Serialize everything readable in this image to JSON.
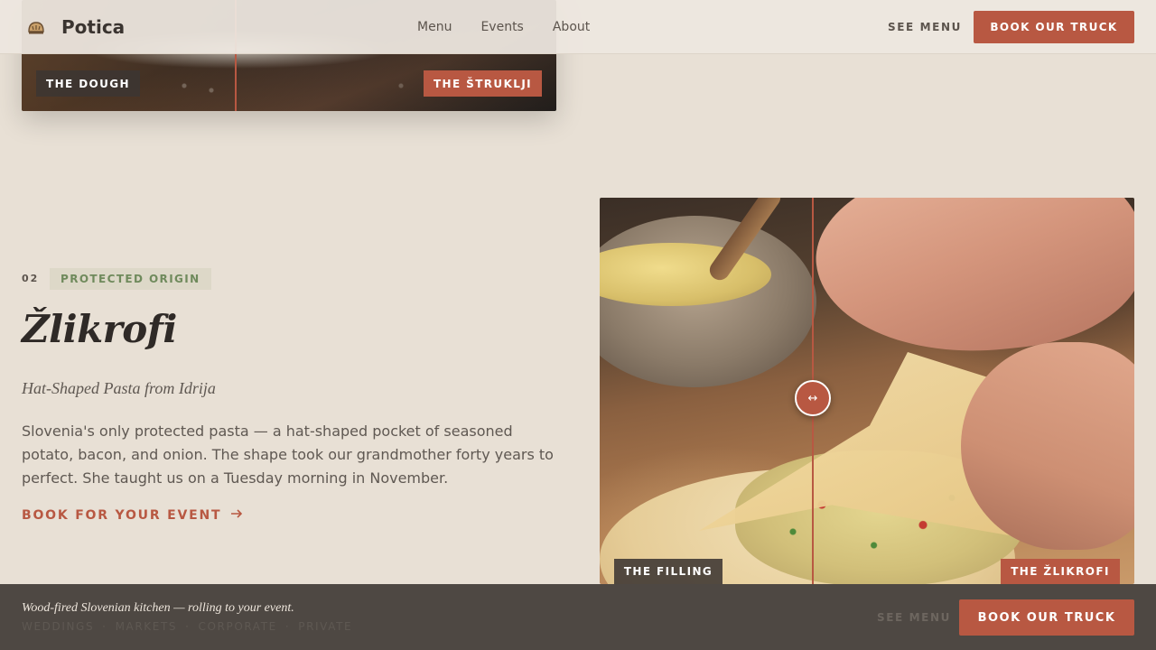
{
  "brand": {
    "name": "Potica",
    "logo_icon": "bread-loaf-icon"
  },
  "nav": {
    "items": [
      "Menu",
      "Events",
      "About"
    ]
  },
  "header": {
    "see_menu": "SEE MENU",
    "book_button": "BOOK OUR TRUCK"
  },
  "prev_slider": {
    "left_label": "THE DOUGH",
    "right_label": "THE ŠTRUKLJI"
  },
  "dish": {
    "number": "02",
    "badge": "PROTECTED ORIGIN",
    "title": "Žlikrofi",
    "subtitle": "Hat-Shaped Pasta from Idrija",
    "description": "Slovenia's only protected pasta — a hat-shaped pocket of seasoned potato, bacon, and onion. The shape took our grandmother forty years to perfect. She taught us on a Tuesday morning in November.",
    "cta": "BOOK FOR YOUR EVENT",
    "cta_icon": "arrow-right-icon",
    "slider": {
      "left_label": "THE FILLING",
      "right_label": "THE ŽLIKROFI",
      "handle_icon": "left-right-arrow-icon",
      "handle_glyph": "↔"
    }
  },
  "footer": {
    "tagline": "Wood-fired Slovenian kitchen — rolling to your event.",
    "event_types": [
      "WEDDINGS",
      "MARKETS",
      "CORPORATE",
      "PRIVATE"
    ],
    "separator": "·",
    "see_menu": "SEE MENU",
    "book_button": "BOOK OUR TRUCK"
  },
  "colors": {
    "accent": "#b85842",
    "background": "#e8e0d5",
    "badge_text": "#6f8a5c",
    "footer_bg": "#48433e"
  }
}
